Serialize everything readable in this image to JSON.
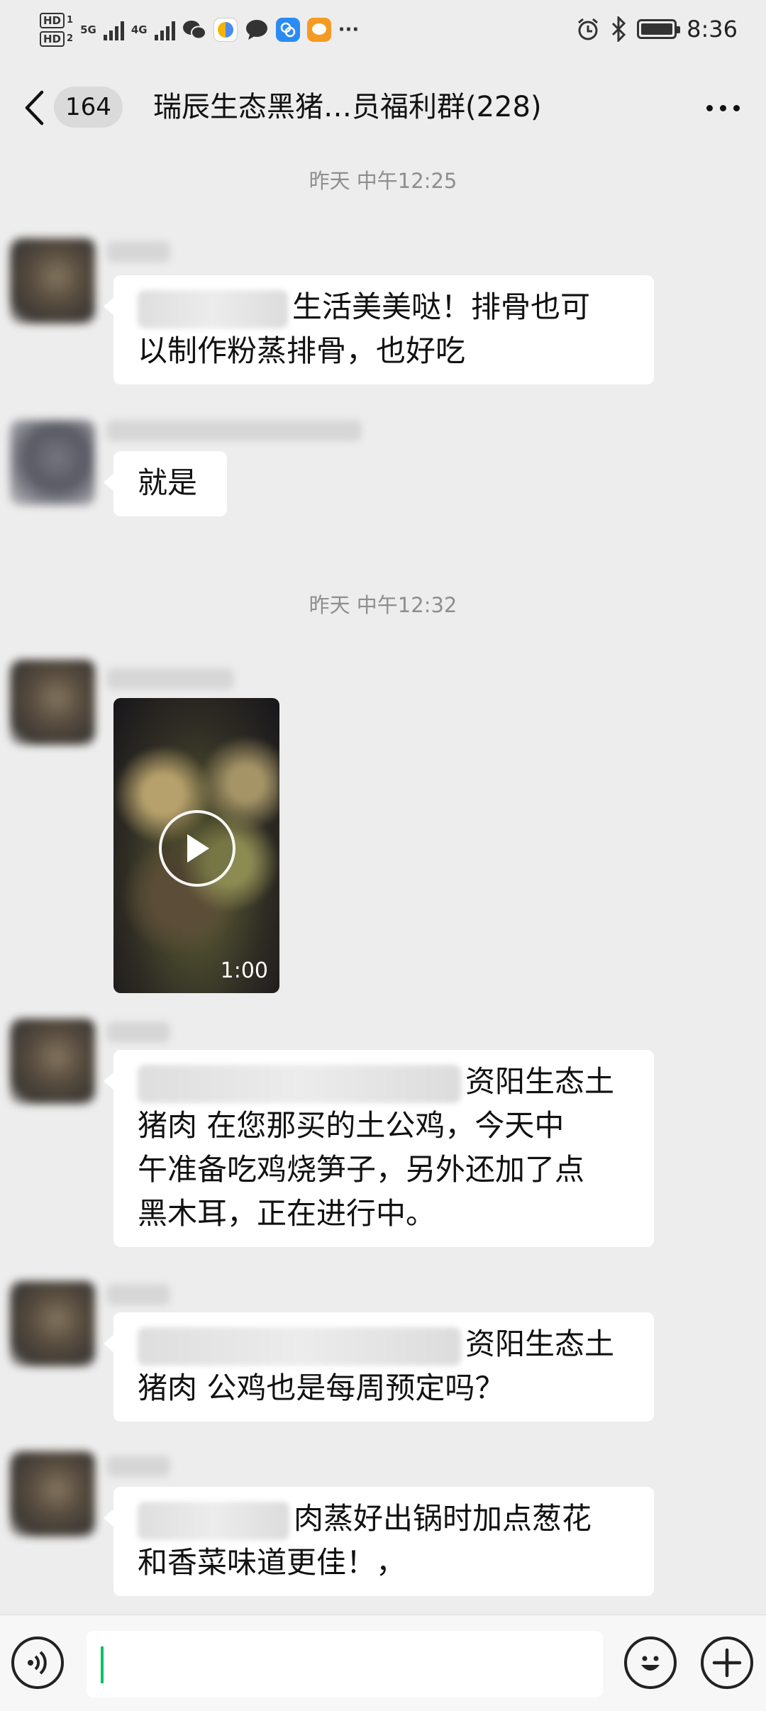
{
  "status_bar": {
    "hd1": "HD",
    "hd1_sub": "1",
    "hd2": "HD",
    "hd2_sub": "2",
    "net1": "5G",
    "net2": "4G",
    "time": "8:36",
    "more": "···"
  },
  "nav": {
    "unread": "164",
    "title": "瑞辰生态黑猪…员福利群(228)"
  },
  "timestamps": {
    "t1": "昨天 中午12:25",
    "t2": "昨天 中午12:32"
  },
  "messages": {
    "m1_line1": "生活美美哒！排骨也可",
    "m1_line2": "以制作粉蒸排骨，也好吃",
    "m2": "就是",
    "video_duration": "1:00",
    "m4_line1": "资阳生态土",
    "m4_line2": "猪肉  在您那买的土公鸡，今天中",
    "m4_line3": "午准备吃鸡烧笋子，另外还加了点",
    "m4_line4": "黑木耳，正在进行中。",
    "m5_line1": "资阳生态土",
    "m5_line2": "猪肉  公鸡也是每周预定吗？",
    "m6_line1": "肉蒸好出锅时加点葱花",
    "m6_line2": "和香菜味道更佳！，"
  },
  "input": {
    "placeholder": ""
  },
  "icons": {
    "back": "chevron-left-icon",
    "more": "more-dots-icon",
    "voice": "voice-icon",
    "emoji": "emoji-icon",
    "plus": "plus-icon",
    "play": "play-icon"
  },
  "colors": {
    "background": "#ededed",
    "bubble": "#ffffff",
    "timestamp": "#8e8e8e",
    "caret": "#07c160"
  }
}
